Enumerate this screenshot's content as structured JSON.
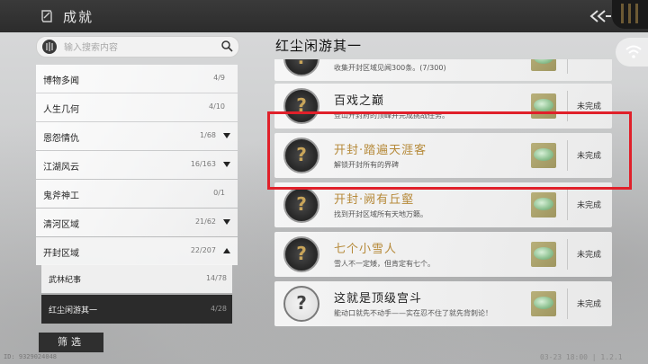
{
  "header": {
    "title": "成就",
    "title_icon": "scroll-icon",
    "back_icon": "double-chevron-left-icon"
  },
  "search": {
    "placeholder": "输入搜索内容"
  },
  "categories": [
    {
      "label": "博物多闻",
      "count": "4/9",
      "arrow": ""
    },
    {
      "label": "人生几何",
      "count": "4/10",
      "arrow": ""
    },
    {
      "label": "恩怨情仇",
      "count": "1/68",
      "arrow": "down"
    },
    {
      "label": "江湖风云",
      "count": "16/163",
      "arrow": "down"
    },
    {
      "label": "鬼斧神工",
      "count": "0/1",
      "arrow": ""
    },
    {
      "label": "清河区域",
      "count": "21/62",
      "arrow": "down"
    },
    {
      "label": "开封区域",
      "count": "22/207",
      "arrow": "up"
    }
  ],
  "subcategories": [
    {
      "label": "武林纪事",
      "count": "14/78",
      "selected": false
    },
    {
      "label": "红尘闲游其一",
      "count": "4/28",
      "selected": true
    }
  ],
  "filter_button": "筛选",
  "uid_text": "ID: 9329024048",
  "version_text": "03-23 18:00 | 1.2.1",
  "section_title": "红尘闲游其一",
  "achievements": [
    {
      "title": "",
      "desc": "收集开封区域见闻300条。(7/300)",
      "status": "",
      "locked": false
    },
    {
      "title": "百戏之巅",
      "desc": "登山开封府的顶峰并完成挑战任务。",
      "status": "未完成",
      "locked": false
    },
    {
      "title": "开封·踏遍天涯客",
      "desc": "解锁开封所有的界碑",
      "status": "未完成",
      "locked": false
    },
    {
      "title": "开封·阙有丘壑",
      "desc": "找到开封区域所有天地万籁。",
      "status": "未完成",
      "locked": false
    },
    {
      "title": "七个小雪人",
      "desc": "雪人不一定矮，但肯定有七个。",
      "status": "未完成",
      "locked": false
    },
    {
      "title": "这就是顶级宫斗",
      "desc": "能动口就先不动手——实在忍不住了就先背刺论！",
      "status": "未完成",
      "locked": true
    }
  ],
  "colors": {
    "accent_gold": "#b68a3a",
    "highlight": "#e0202a",
    "dark_panel": "#2b2b2b"
  }
}
